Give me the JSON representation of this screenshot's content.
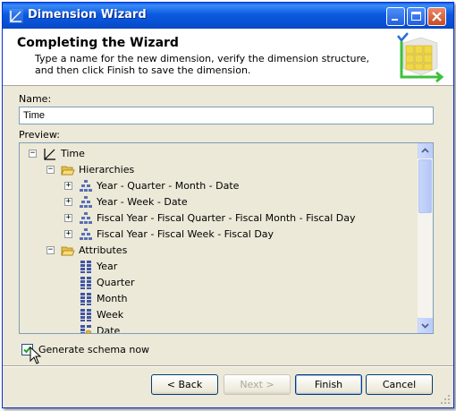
{
  "window": {
    "title": "Dimension Wizard"
  },
  "header": {
    "title": "Completing the Wizard",
    "description": "Type a name for the new dimension, verify the dimension structure, and then click Finish to save the dimension."
  },
  "name": {
    "label": "Name:",
    "value": "Time"
  },
  "preview": {
    "label": "Preview:",
    "root": "Time",
    "hierarchies_label": "Hierarchies",
    "hierarchies": [
      "Year - Quarter - Month - Date",
      "Year - Week - Date",
      "Fiscal Year - Fiscal Quarter - Fiscal Month - Fiscal Day",
      "Fiscal Year - Fiscal Week - Fiscal Day"
    ],
    "attributes_label": "Attributes",
    "attributes": [
      "Year",
      "Quarter",
      "Month",
      "Week",
      "Date"
    ]
  },
  "generate": {
    "label": "Generate schema now",
    "checked": true
  },
  "buttons": {
    "back": "< Back",
    "next": "Next >",
    "finish": "Finish",
    "cancel": "Cancel"
  },
  "colors": {
    "titlebar": "#0a5fe8",
    "dialog_bg": "#ece9d8",
    "input_border": "#7f9db9",
    "check": "#21a121"
  }
}
